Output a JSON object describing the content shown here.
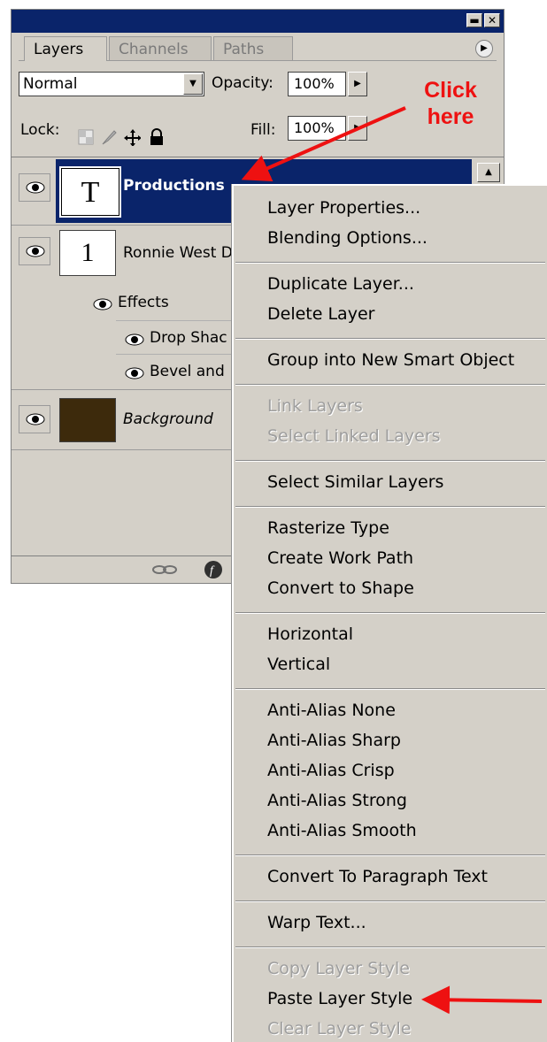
{
  "panel": {
    "tabs": [
      "Layers",
      "Channels",
      "Paths"
    ],
    "blend_mode": "Normal",
    "opacity_label": "Opacity:",
    "opacity_value": "100%",
    "lock_label": "Lock:",
    "fill_label": "Fill:",
    "fill_value": "100%",
    "titlebar_buttons": [
      "minimize-icon",
      "close-icon"
    ],
    "panel_menu_icon": "flyout-arrow-icon",
    "layers": [
      {
        "name": "Productions",
        "thumb": "T",
        "selected": true
      },
      {
        "name": "Ronnie West D",
        "thumb": "1"
      },
      {
        "name": "Background",
        "italic": true,
        "thumb_color": "#3d2a0c"
      }
    ],
    "effects_label": "Effects",
    "effects": [
      "Drop Shac",
      "Bevel and"
    ]
  },
  "annotation": {
    "click_here": [
      "Click",
      "here"
    ],
    "color": "#ee1111"
  },
  "menu": {
    "groups": [
      [
        {
          "label": "Layer Properties..."
        },
        {
          "label": "Blending Options..."
        }
      ],
      [
        {
          "label": "Duplicate Layer..."
        },
        {
          "label": "Delete Layer"
        }
      ],
      [
        {
          "label": "Group into New Smart Object"
        }
      ],
      [
        {
          "label": "Link Layers",
          "disabled": true
        },
        {
          "label": "Select Linked Layers",
          "disabled": true
        }
      ],
      [
        {
          "label": "Select Similar Layers"
        }
      ],
      [
        {
          "label": "Rasterize Type"
        },
        {
          "label": "Create Work Path"
        },
        {
          "label": "Convert to Shape"
        }
      ],
      [
        {
          "label": "Horizontal"
        },
        {
          "label": "Vertical"
        }
      ],
      [
        {
          "label": "Anti-Alias None"
        },
        {
          "label": "Anti-Alias Sharp"
        },
        {
          "label": "Anti-Alias Crisp"
        },
        {
          "label": "Anti-Alias Strong"
        },
        {
          "label": "Anti-Alias Smooth"
        }
      ],
      [
        {
          "label": "Convert To Paragraph Text"
        }
      ],
      [
        {
          "label": "Warp Text..."
        }
      ],
      [
        {
          "label": "Copy Layer Style",
          "disabled": true
        },
        {
          "label": "Paste Layer Style"
        },
        {
          "label": "Clear Layer Style",
          "disabled": true
        }
      ]
    ]
  },
  "colors": {
    "titlebar": "#0a246a",
    "panel_bg": "#d4d0c8",
    "selection": "#0a246a",
    "arrow": "#ee1111"
  }
}
